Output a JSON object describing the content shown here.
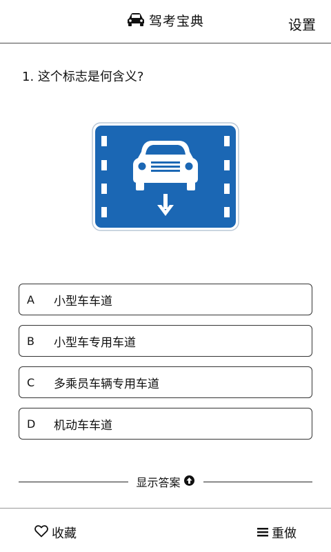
{
  "header": {
    "title": "驾考宝典",
    "brand_icon": "car-icon",
    "settings_label": "设置"
  },
  "question": {
    "text": "1. 这个标志是何含义?"
  },
  "sign": {
    "icon": "small-car-lane-sign",
    "background_color": "#1b67b4",
    "symbol_color": "#ffffff"
  },
  "options": [
    {
      "letter": "A",
      "text": "小型车车道"
    },
    {
      "letter": "B",
      "text": "小型车专用车道"
    },
    {
      "letter": "C",
      "text": "多乘员车辆专用车道"
    },
    {
      "letter": "D",
      "text": "机动车车道"
    }
  ],
  "show_answer": {
    "label": "显示答案",
    "icon": "arrow-up-circle-icon"
  },
  "footer": {
    "favorite_label": "收藏",
    "favorite_icon": "heart-icon",
    "redo_label": "重做",
    "redo_icon": "menu-icon"
  }
}
